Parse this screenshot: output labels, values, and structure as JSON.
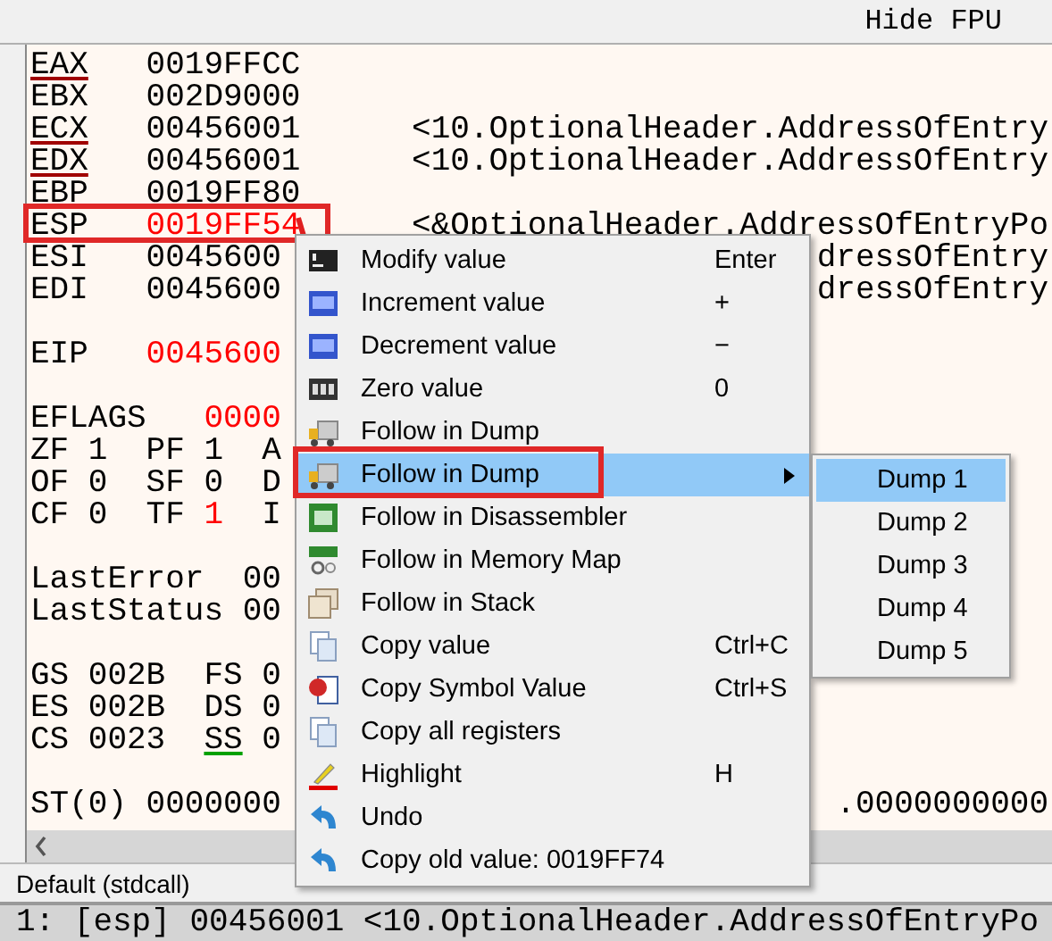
{
  "toolbar": {
    "button": "Hide FPU"
  },
  "lines": [
    {
      "kind": "reg",
      "name": "EAX",
      "value": "0019FFCC",
      "changed": false,
      "modified": true
    },
    {
      "kind": "reg",
      "name": "EBX",
      "value": "002D9000",
      "changed": false
    },
    {
      "kind": "reg",
      "name": "ECX",
      "value": "00456001",
      "changed": false,
      "modified": true,
      "comment": "<10.OptionalHeader.AddressOfEntry"
    },
    {
      "kind": "reg",
      "name": "EDX",
      "value": "00456001",
      "changed": false,
      "modified": true,
      "comment": "<10.OptionalHeader.AddressOfEntry"
    },
    {
      "kind": "reg",
      "name": "EBP",
      "value": "0019FF80",
      "changed": false
    },
    {
      "kind": "reg",
      "name": "ESP",
      "value": "0019FF54",
      "changed": true,
      "comment": "<&OptionalHeader.AddressOfEntryPo"
    },
    {
      "kind": "reg",
      "name": "ESI",
      "value": "0045600",
      "changed": false,
      "comment": "dressOfEntry"
    },
    {
      "kind": "reg",
      "name": "EDI",
      "value": "0045600",
      "changed": false,
      "comment": "dressOfEntry"
    },
    {
      "kind": "blank"
    },
    {
      "kind": "reg",
      "name": "EIP",
      "value": "0045600",
      "changed": true
    },
    {
      "kind": "blank"
    },
    {
      "kind": "wide",
      "name": "EFLAGS",
      "value": "0000",
      "changed": true
    },
    {
      "kind": "flags",
      "cells": [
        {
          "name": "ZF",
          "value": "1",
          "changed": false
        },
        {
          "name": "PF",
          "value": "1",
          "changed": false
        },
        {
          "name": "A"
        }
      ]
    },
    {
      "kind": "flags",
      "cells": [
        {
          "name": "OF",
          "value": "0",
          "changed": false
        },
        {
          "name": "SF",
          "value": "0",
          "changed": false
        },
        {
          "name": "D"
        }
      ]
    },
    {
      "kind": "flags",
      "cells": [
        {
          "name": "CF",
          "value": "0",
          "changed": false
        },
        {
          "name": "TF",
          "value": "1",
          "changed": true
        },
        {
          "name": "I"
        }
      ]
    },
    {
      "kind": "blank"
    },
    {
      "kind": "last",
      "name": "LastError",
      "value": "00",
      "changed": false
    },
    {
      "kind": "last",
      "name": "LastStatus",
      "value": "00",
      "changed": false
    },
    {
      "kind": "blank"
    },
    {
      "kind": "seg",
      "cells": [
        {
          "name": "GS",
          "value": "002B"
        },
        {
          "name": "FS",
          "value": "0"
        }
      ]
    },
    {
      "kind": "seg",
      "cells": [
        {
          "name": "ES",
          "value": "002B"
        },
        {
          "name": "DS",
          "value": "0"
        }
      ]
    },
    {
      "kind": "seg",
      "cells": [
        {
          "name": "CS",
          "value": "0023"
        },
        {
          "name": "SS",
          "value": "0",
          "current": true
        }
      ]
    },
    {
      "kind": "blank"
    },
    {
      "kind": "reg",
      "name": "ST(0)",
      "value": "0000000",
      "changed": false,
      "comment": ".0000000000"
    }
  ],
  "menu": [
    {
      "label": "Modify value",
      "shortcut": "Enter",
      "selected": false
    },
    {
      "label": "Increment value",
      "shortcut": "+",
      "selected": false
    },
    {
      "label": "Decrement value",
      "shortcut": "−",
      "selected": false
    },
    {
      "label": "Zero value",
      "shortcut": "0",
      "selected": false
    },
    {
      "label": "Follow in Dump",
      "selected": false
    },
    {
      "label": "Follow in Dump",
      "selected": true,
      "submenu": true
    },
    {
      "label": "Follow in Disassembler",
      "selected": false
    },
    {
      "label": "Follow in Memory Map",
      "selected": false
    },
    {
      "label": "Follow in Stack",
      "selected": false
    },
    {
      "label": "Copy value",
      "shortcut": "Ctrl+C",
      "selected": false
    },
    {
      "label": "Copy Symbol Value",
      "shortcut": "Ctrl+S",
      "selected": false
    },
    {
      "label": "Copy all registers",
      "selected": false
    },
    {
      "label": "Highlight",
      "shortcut": "H",
      "selected": false
    },
    {
      "label": "Undo",
      "selected": false
    },
    {
      "label": "Copy old value: 0019FF74",
      "selected": false
    }
  ],
  "submenu": [
    {
      "label": "Dump 1",
      "selected": true
    },
    {
      "label": "Dump 2",
      "selected": false
    },
    {
      "label": "Dump 3",
      "selected": false
    },
    {
      "label": "Dump 4",
      "selected": false
    },
    {
      "label": "Dump 5",
      "selected": false
    }
  ],
  "calling_convention": "Default (stdcall)",
  "stack_line": "1: [esp] 00456001 <10.OptionalHeader.AddressOfEntryPo"
}
